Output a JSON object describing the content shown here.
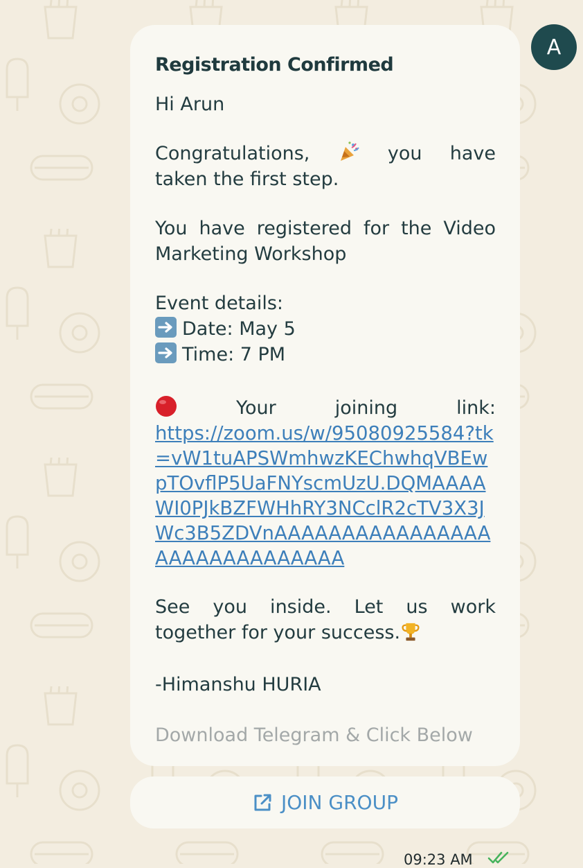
{
  "message": {
    "title": "Registration Confirmed",
    "greeting": "Hi Arun",
    "congrats_word": "Congratulations,",
    "congrats_rest_a": "you have",
    "congrats_rest_b": "taken the first step.",
    "registered": "You have registered for the Video Marketing Workshop",
    "event_heading": "Event details:",
    "date_line": "Date: May 5",
    "time_line": "Time: 7 PM",
    "joining_label_a": "Your",
    "joining_label_b": "joining",
    "joining_label_c": "link:",
    "link": "https://zoom.us/w/95080925584?tk=vW1tuAPSWmhwzKEChwhqVBEwpTOvflP5UaFNYscmUzU.DQMAAAAWI0PJkBZFWHhRY3NCclR2cTV3X3JWc3B5ZDVnAAAAAAAAAAAAAAAAAAAAAAAAAAAAAA",
    "closing": "See you inside. Let us work together for your success.",
    "signature": "-Himanshu HURIA",
    "footer": "Download Telegram & Click Below"
  },
  "join_button": {
    "label": "JOIN GROUP",
    "icon": "external-link-icon"
  },
  "avatar": {
    "initial": "A"
  },
  "meta": {
    "timestamp": "09:23 AM",
    "status_icon": "double-check-icon"
  },
  "colors": {
    "background": "#f3ede0",
    "bubble": "#f9f8f2",
    "text": "#233c40",
    "link": "#3d7fba",
    "avatar": "#1f4a4e",
    "button_text": "#4b8fc6",
    "read_tick": "#46b35c"
  }
}
